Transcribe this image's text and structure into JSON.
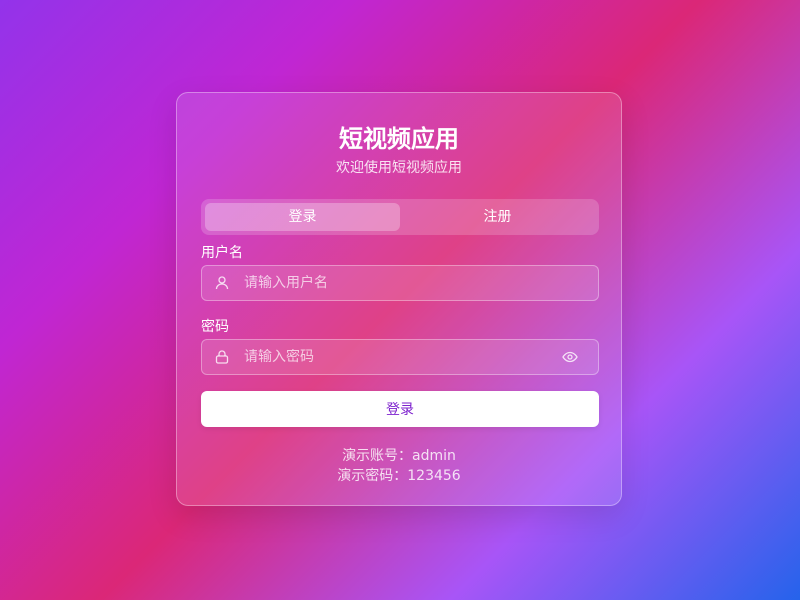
{
  "app": {
    "title": "短视频应用",
    "subtitle": "欢迎使用短视频应用"
  },
  "tabs": [
    {
      "label": "登录",
      "active": true
    },
    {
      "label": "注册",
      "active": false
    }
  ],
  "form": {
    "username": {
      "label": "用户名",
      "placeholder": "请输入用户名",
      "value": "",
      "icon": "user-icon"
    },
    "password": {
      "label": "密码",
      "placeholder": "请输入密码",
      "value": "",
      "icon": "lock-icon",
      "toggle_icon": "eye-icon"
    },
    "submit_label": "登录"
  },
  "demo": {
    "account": "演示账号：admin",
    "password": "演示密码：123456"
  },
  "colors": {
    "accent": "#7e22ce",
    "gradient": [
      "#9333ea",
      "#db2777",
      "#2563eb"
    ]
  }
}
